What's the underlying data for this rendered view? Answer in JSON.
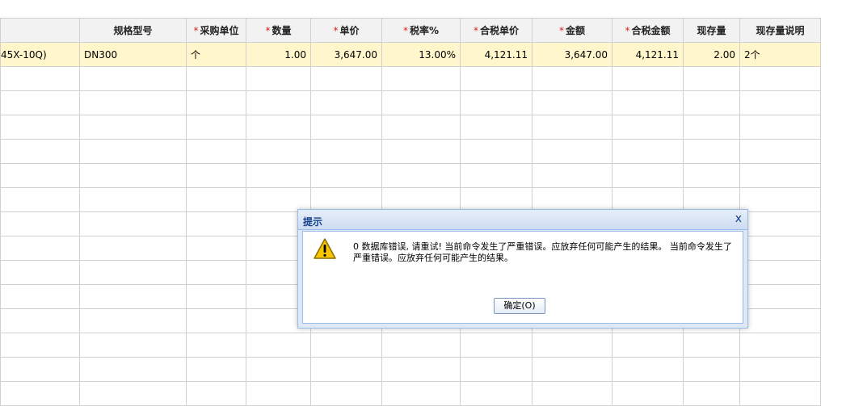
{
  "grid": {
    "columns": [
      {
        "label": "",
        "required": false
      },
      {
        "label": "规格型号",
        "required": false
      },
      {
        "label": "采购单位",
        "required": true
      },
      {
        "label": "数量",
        "required": true
      },
      {
        "label": "单价",
        "required": true
      },
      {
        "label": "税率%",
        "required": true
      },
      {
        "label": "合税单价",
        "required": true
      },
      {
        "label": "金额",
        "required": true
      },
      {
        "label": "合税金额",
        "required": true
      },
      {
        "label": "现存量",
        "required": false
      },
      {
        "label": "现存量说明",
        "required": false
      }
    ],
    "rows": [
      {
        "name": "45X-10Q)",
        "spec": "DN300",
        "unit": "个",
        "qty": "1.00",
        "price": "3,647.00",
        "tax_rate": "13.00%",
        "tax_price": "4,121.11",
        "amount": "3,647.00",
        "tax_amount": "4,121.11",
        "stock": "2.00",
        "stock_note": "2个"
      }
    ],
    "selected_row_color": "#fff6cc",
    "required_mark_color": "#e02020"
  },
  "dialog": {
    "title": "提示",
    "close_symbol": "x",
    "icon": "warning-icon",
    "message": "0 数据库错误, 请重试! 当前命令发生了严重错误。应放弃任何可能产生的结果。 当前命令发生了严重错误。应放弃任何可能产生的结果。",
    "ok_label": "确定(O)"
  }
}
